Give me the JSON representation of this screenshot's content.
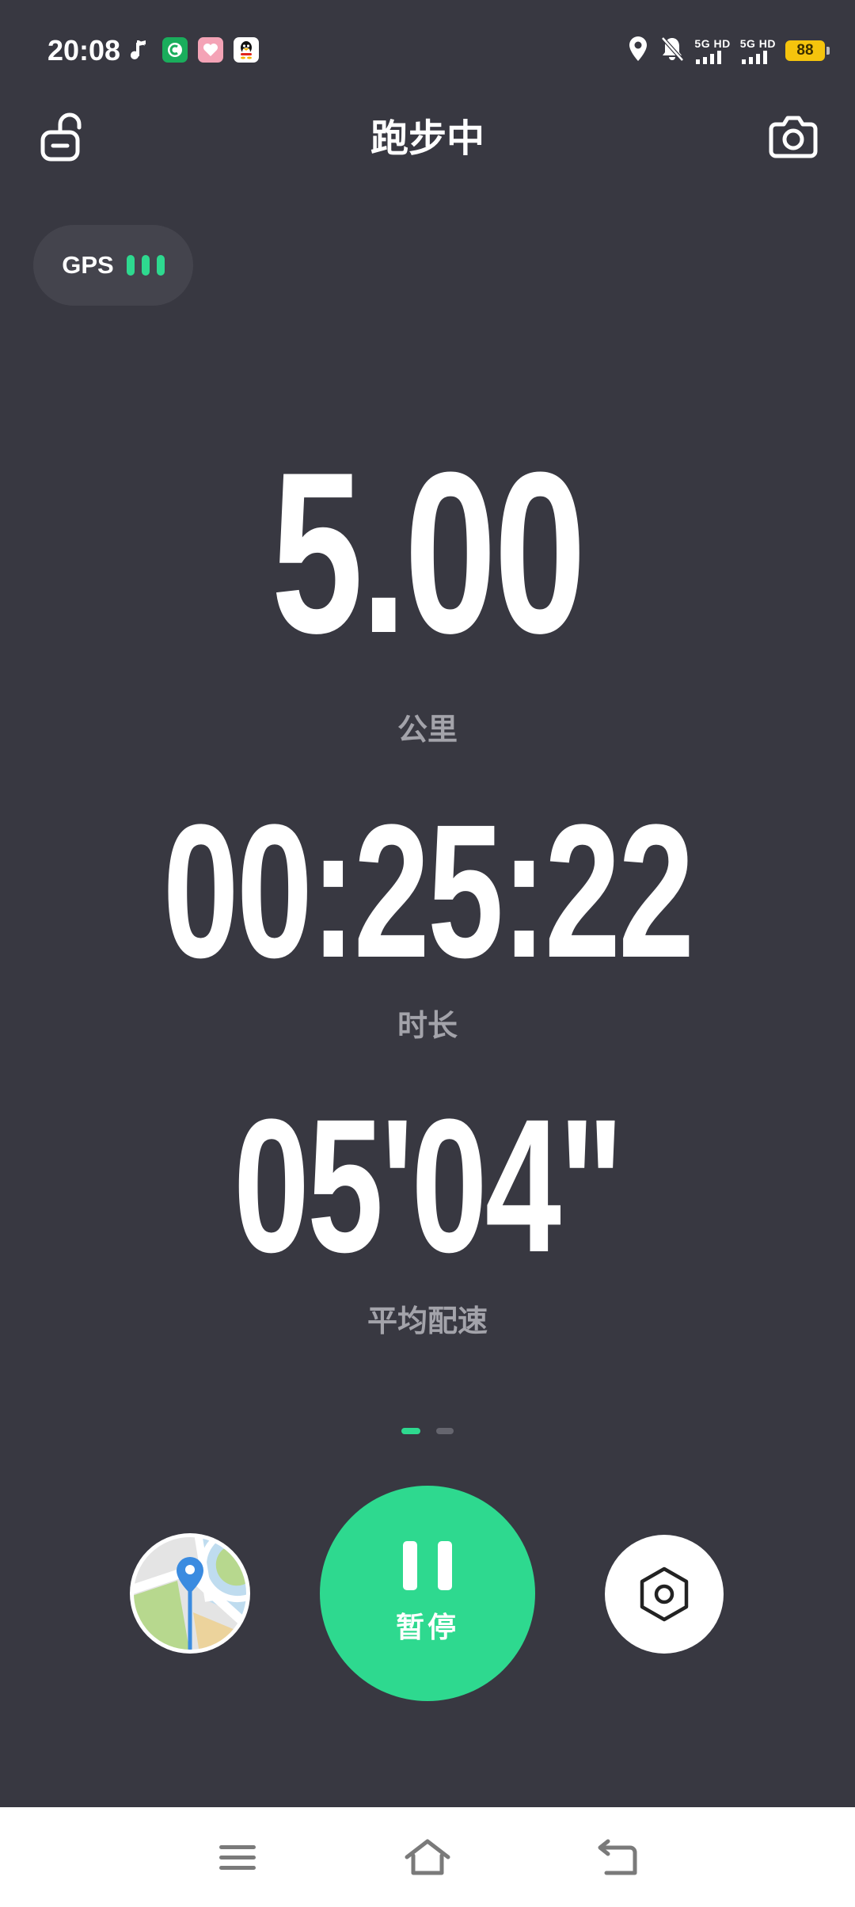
{
  "status_bar": {
    "time": "20:08",
    "apps": [
      {
        "icon": "music-note-icon",
        "color": "#ffffff"
      },
      {
        "icon": "green-app-icon",
        "color": "#1aad5c"
      },
      {
        "icon": "heart-app-icon",
        "color": "#f4a3b6"
      },
      {
        "icon": "qq-penguin-icon",
        "color": "#ffffff"
      }
    ],
    "signal_1": "5G HD",
    "signal_2": "5G HD",
    "battery": "88",
    "battery_color": "#f5c40d"
  },
  "header": {
    "title": "跑步中"
  },
  "gps": {
    "label": "GPS",
    "bars_color": "#2ed98f"
  },
  "metrics": {
    "distance": {
      "value": "5.00",
      "label": "公里"
    },
    "duration": {
      "value": "00:25:22",
      "label": "时长"
    },
    "pace": {
      "value": "05'04\"",
      "label": "平均配速"
    }
  },
  "pager": {
    "pages": 2,
    "active_index": 0
  },
  "controls": {
    "pause_label": "暂停",
    "accent_color": "#2ed98f"
  },
  "colors": {
    "background": "#383841",
    "label_gray": "#a3a3aa"
  }
}
